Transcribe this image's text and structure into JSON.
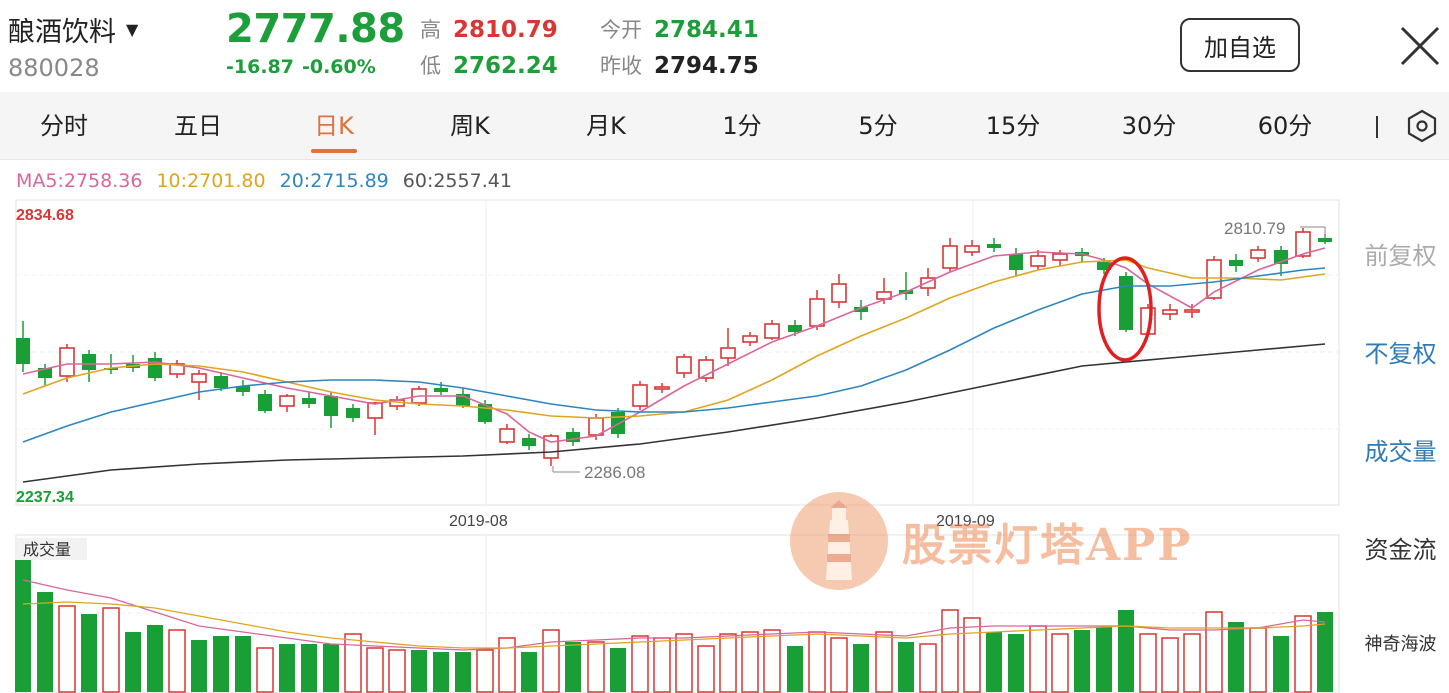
{
  "header": {
    "name": "酿酒饮料",
    "caret": "▼",
    "code": "880028",
    "price": "2777.88",
    "change": "-16.87",
    "change_pct": "-0.60%",
    "high_label": "高",
    "high": "2810.79",
    "low_label": "低",
    "low": "2762.24",
    "open_label": "今开",
    "open": "2784.41",
    "prev_label": "昨收",
    "prev_close": "2794.75",
    "add_button": "加自选"
  },
  "tabs": [
    {
      "label": "分时"
    },
    {
      "label": "五日"
    },
    {
      "label": "日K",
      "active": true
    },
    {
      "label": "周K"
    },
    {
      "label": "月K"
    },
    {
      "label": "1分"
    },
    {
      "label": "5分"
    },
    {
      "label": "15分"
    },
    {
      "label": "30分"
    },
    {
      "label": "60分"
    }
  ],
  "ma": {
    "ma5": "MA5:2758.36",
    "ma10": "10:2701.80",
    "ma20": "20:2715.89",
    "ma60": "60:2557.41"
  },
  "chart": {
    "y_max_label": "2834.68",
    "y_min_label": "2237.34",
    "max_marker": "2810.79",
    "min_marker": "2286.08",
    "x_labels": [
      "2019-08",
      "2019-09"
    ],
    "volume_label": "成交量",
    "colors": {
      "up": "#d93636",
      "down": "#1a9e36",
      "ma5": "#d9669c",
      "ma10": "#e0a520",
      "ma20": "#2e86c1",
      "ma60": "#333333"
    }
  },
  "side_menu": {
    "fq_before": "前复权",
    "fq_none": "不复权",
    "volume": "成交量",
    "fund_flow": "资金流",
    "magic_wave": "神奇海波"
  },
  "watermark": {
    "text": "股票灯塔APP"
  }
}
